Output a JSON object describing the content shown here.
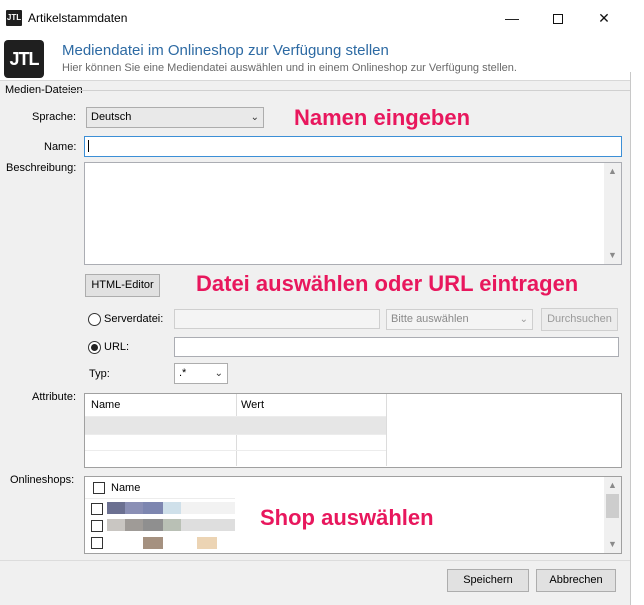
{
  "window": {
    "title": "Artikelstammdaten",
    "app_icon_text": "JTL",
    "minimize": "—",
    "close": "✕"
  },
  "header": {
    "logo_text": "JTL",
    "title": "Mediendatei im Onlineshop zur Verfügung stellen",
    "subtitle": "Hier können Sie eine Mediendatei auswählen und in einem Onlineshop zur Verfügung stellen."
  },
  "form": {
    "group_label": "Medien-Dateien",
    "language_label": "Sprache:",
    "language_value": "Deutsch",
    "name_label": "Name:",
    "name_value": "",
    "description_label": "Beschreibung:",
    "html_editor_button": "HTML-Editor",
    "serverfile_label": "Serverdatei:",
    "serverfile_combo": "Bitte auswählen",
    "browse_button": "Durchsuchen",
    "url_label": "URL:",
    "type_label": "Typ:",
    "type_value": ".*",
    "attributes_label": "Attribute:",
    "attributes_columns": [
      "Name",
      "Wert"
    ],
    "onlineshops_label": "Onlineshops:",
    "onlineshops_column": "Name"
  },
  "annotations": {
    "name_hint": "Namen eingeben",
    "file_hint": "Datei auswählen oder URL eintragen",
    "shop_hint": "Shop auswählen"
  },
  "footer": {
    "save_button": "Speichern",
    "cancel_button": "Abbrechen"
  },
  "colors": {
    "header_title": "#2d6aa3",
    "annotation": "#e8175d",
    "focus_border": "#3c8fd6"
  }
}
